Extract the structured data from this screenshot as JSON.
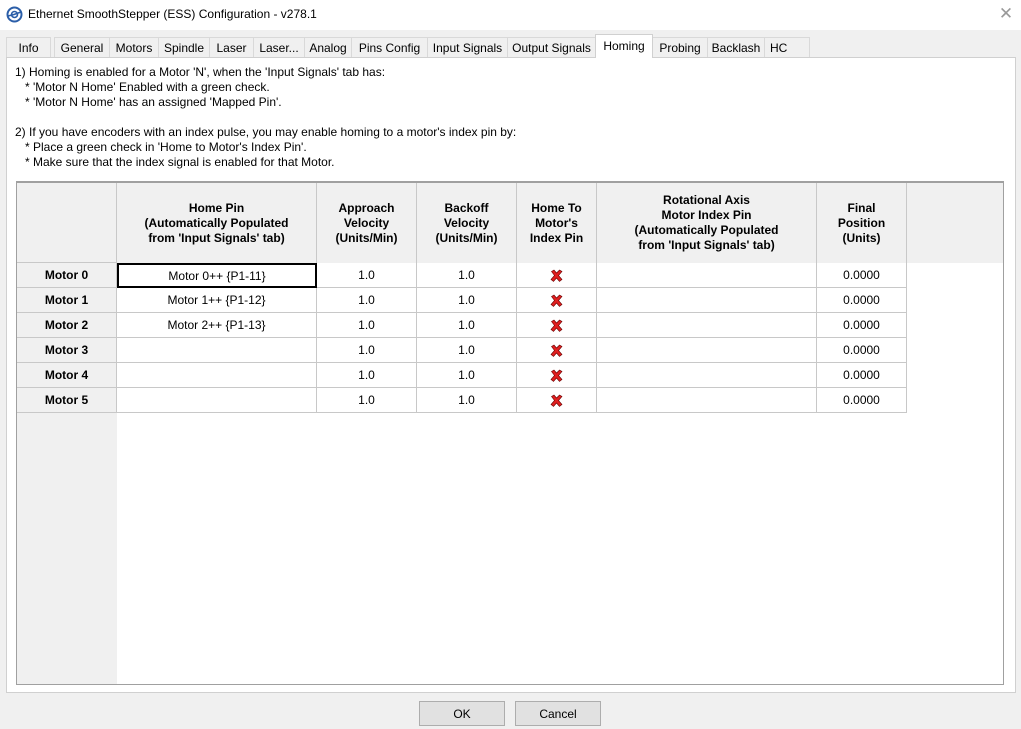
{
  "window": {
    "title": "Ethernet SmoothStepper (ESS) Configuration - v278.1",
    "close_glyph": "✕"
  },
  "tabs": [
    {
      "label": "Info",
      "active": false
    },
    {
      "label": "General",
      "active": false
    },
    {
      "label": "Motors",
      "active": false
    },
    {
      "label": "Spindle",
      "active": false
    },
    {
      "label": "Laser",
      "active": false
    },
    {
      "label": "Laser...",
      "active": false
    },
    {
      "label": "Analog",
      "active": false
    },
    {
      "label": "Pins Config",
      "active": false
    },
    {
      "label": "Input Signals",
      "active": false
    },
    {
      "label": "Output Signals",
      "active": false
    },
    {
      "label": "Homing",
      "active": true
    },
    {
      "label": "Probing",
      "active": false
    },
    {
      "label": "Backlash",
      "active": false
    },
    {
      "label": "HC",
      "active": false
    }
  ],
  "instructions": {
    "line1": "1) Homing is enabled for a Motor 'N', when the 'Input Signals' tab has:",
    "line2": "   * 'Motor N Home' Enabled with a green check.",
    "line3": "   * 'Motor N Home' has an assigned 'Mapped Pin'.",
    "line4": "",
    "line5": "2) If you have encoders with an index pulse, you may enable homing to a motor's index pin by:",
    "line6": "   * Place a green check in 'Home to Motor's Index Pin'.",
    "line7": "   * Make sure that the index signal is enabled for that Motor."
  },
  "grid": {
    "columns": [
      "Home Pin\n(Automatically Populated\nfrom 'Input Signals' tab)",
      "Approach\nVelocity\n(Units/Min)",
      "Backoff\nVelocity\n(Units/Min)",
      "Home To\nMotor's\nIndex Pin",
      "Rotational Axis\nMotor Index Pin\n(Automatically Populated\nfrom 'Input Signals' tab)",
      "Final\nPosition\n(Units)"
    ],
    "rows": [
      {
        "label": "Motor 0",
        "home_pin": "Motor 0++ {P1-11}",
        "approach": "1.0",
        "backoff": "1.0",
        "index": false,
        "rot_pin": "",
        "final": "0.0000"
      },
      {
        "label": "Motor 1",
        "home_pin": "Motor 1++ {P1-12}",
        "approach": "1.0",
        "backoff": "1.0",
        "index": false,
        "rot_pin": "",
        "final": "0.0000"
      },
      {
        "label": "Motor 2",
        "home_pin": "Motor 2++ {P1-13}",
        "approach": "1.0",
        "backoff": "1.0",
        "index": false,
        "rot_pin": "",
        "final": "0.0000"
      },
      {
        "label": "Motor 3",
        "home_pin": "",
        "approach": "1.0",
        "backoff": "1.0",
        "index": false,
        "rot_pin": "",
        "final": "0.0000"
      },
      {
        "label": "Motor 4",
        "home_pin": "",
        "approach": "1.0",
        "backoff": "1.0",
        "index": false,
        "rot_pin": "",
        "final": "0.0000"
      },
      {
        "label": "Motor 5",
        "home_pin": "",
        "approach": "1.0",
        "backoff": "1.0",
        "index": false,
        "rot_pin": "",
        "final": "0.0000"
      }
    ],
    "selected_row": 0,
    "unchecked_icon": "red-x-icon",
    "unchecked_color": "#e02020"
  },
  "buttons": {
    "ok": "OK",
    "cancel": "Cancel"
  }
}
